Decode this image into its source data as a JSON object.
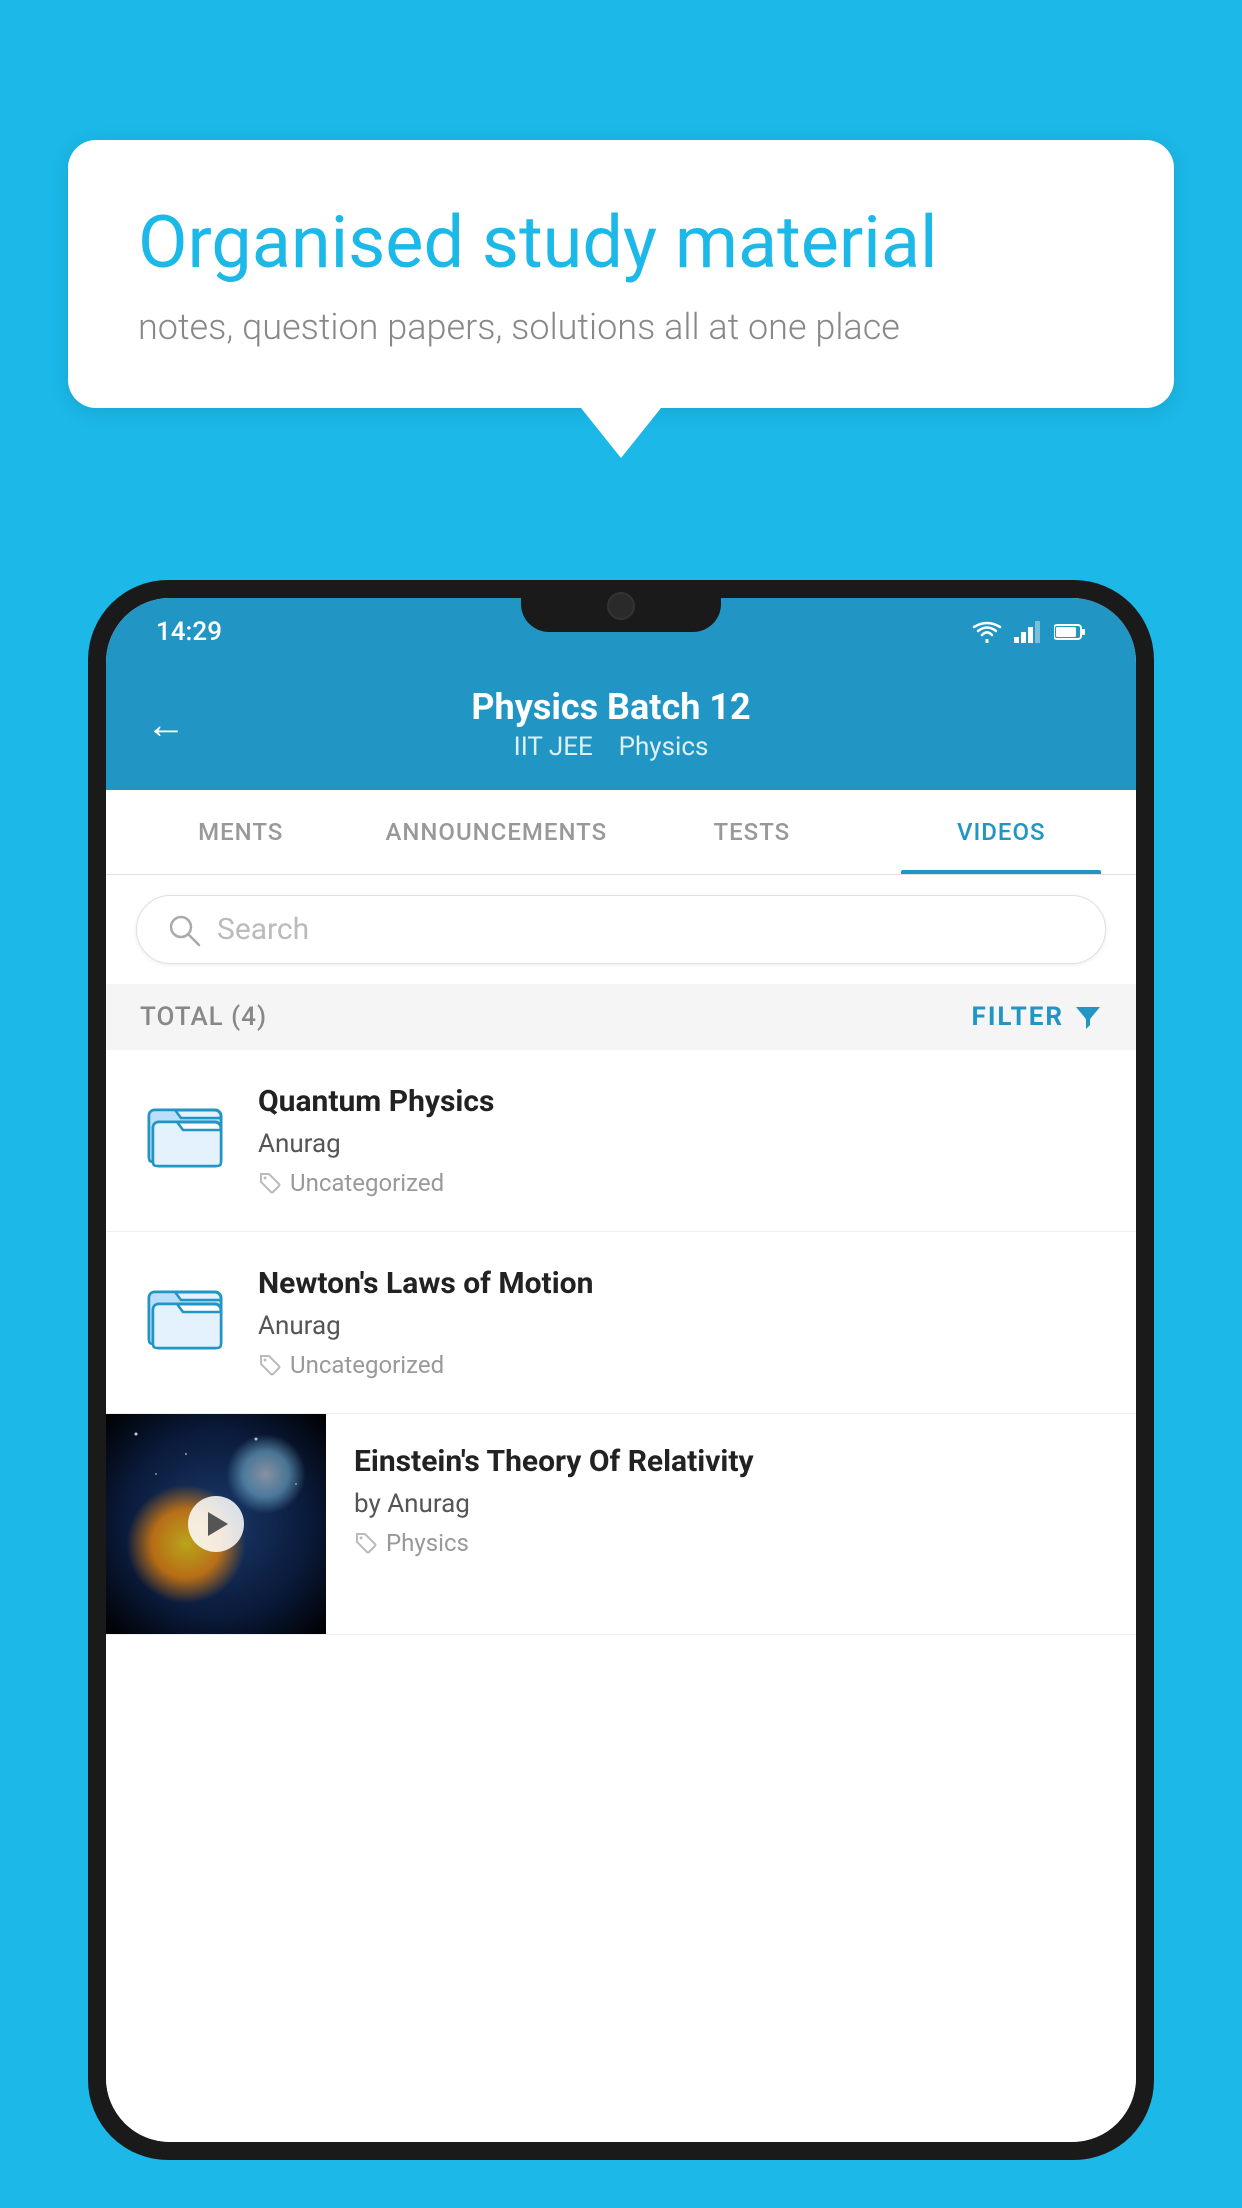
{
  "background_color": "#1bb8e8",
  "speech_bubble": {
    "title": "Organised study material",
    "subtitle": "notes, question papers, solutions all at one place"
  },
  "phone": {
    "status_bar": {
      "time": "14:29",
      "icons": [
        "wifi",
        "signal",
        "battery"
      ]
    },
    "header": {
      "back_label": "←",
      "title": "Physics Batch 12",
      "subtitle_parts": [
        "IIT JEE",
        "Physics"
      ]
    },
    "tabs": [
      {
        "label": "MENTS",
        "active": false
      },
      {
        "label": "ANNOUNCEMENTS",
        "active": false
      },
      {
        "label": "TESTS",
        "active": false
      },
      {
        "label": "VIDEOS",
        "active": true
      }
    ],
    "search": {
      "placeholder": "Search"
    },
    "filter_row": {
      "total_label": "TOTAL (4)",
      "filter_label": "FILTER"
    },
    "videos": [
      {
        "title": "Quantum Physics",
        "author": "Anurag",
        "tag": "Uncategorized",
        "type": "folder"
      },
      {
        "title": "Newton's Laws of Motion",
        "author": "Anurag",
        "tag": "Uncategorized",
        "type": "folder"
      },
      {
        "title": "Einstein's Theory Of Relativity",
        "author": "by Anurag",
        "tag": "Physics",
        "type": "video"
      }
    ]
  }
}
